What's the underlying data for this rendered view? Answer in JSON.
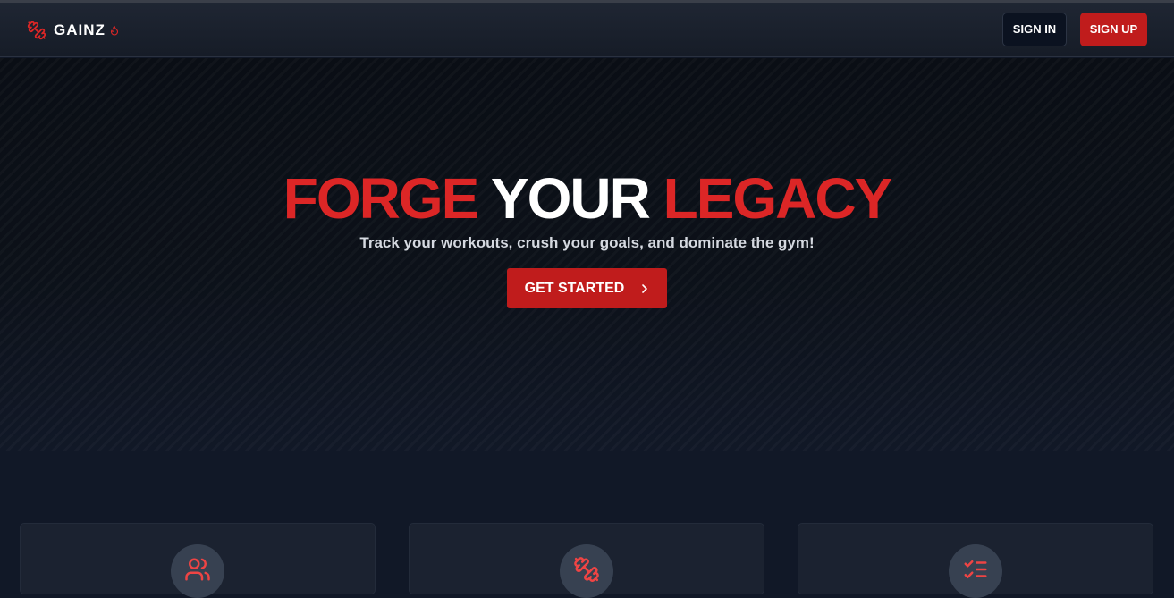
{
  "header": {
    "brand": {
      "name": "GAINZ",
      "icon": "dumbbell-icon",
      "badge_icon": "flame-icon"
    },
    "sign_in_label": "SIGN IN",
    "sign_up_label": "SIGN UP"
  },
  "hero": {
    "title_parts": [
      "FORGE",
      "YOUR",
      "LEGACY"
    ],
    "subtitle": "Track your workouts, crush your goals, and dominate the gym!",
    "cta_label": "GET STARTED",
    "cta_icon": "chevron-right-icon"
  },
  "features": [
    {
      "icon": "users-icon"
    },
    {
      "icon": "dumbbell-icon"
    },
    {
      "icon": "checklist-icon"
    }
  ],
  "colors": {
    "accent": "#dc2626",
    "button_red": "#c01c1c",
    "background": "#111827",
    "card": "#1b2230"
  }
}
